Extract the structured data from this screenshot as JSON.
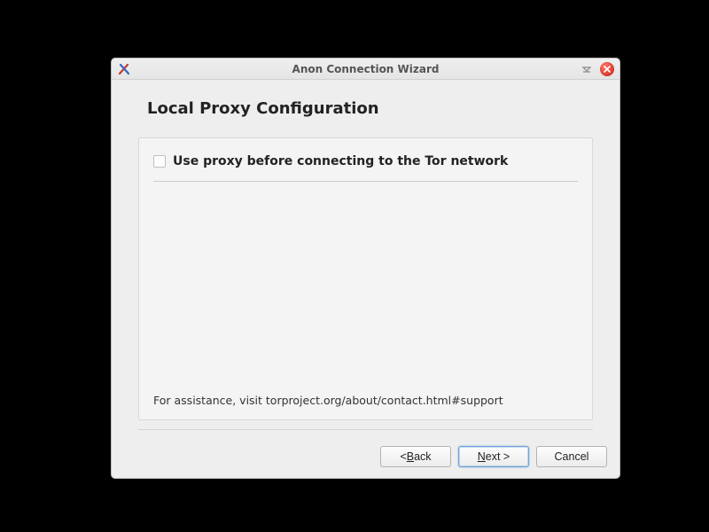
{
  "window": {
    "title": "Anon Connection Wizard"
  },
  "page": {
    "heading": "Local Proxy Configuration",
    "checkbox_label": "Use proxy before connecting to the Tor network",
    "checkbox_checked": false,
    "assistance": "For assistance, visit torproject.org/about/contact.html#support"
  },
  "buttons": {
    "back_prefix": "< ",
    "back_mn": "B",
    "back_suffix": "ack",
    "next_mn": "N",
    "next_suffix": "ext >",
    "cancel": "Cancel"
  }
}
